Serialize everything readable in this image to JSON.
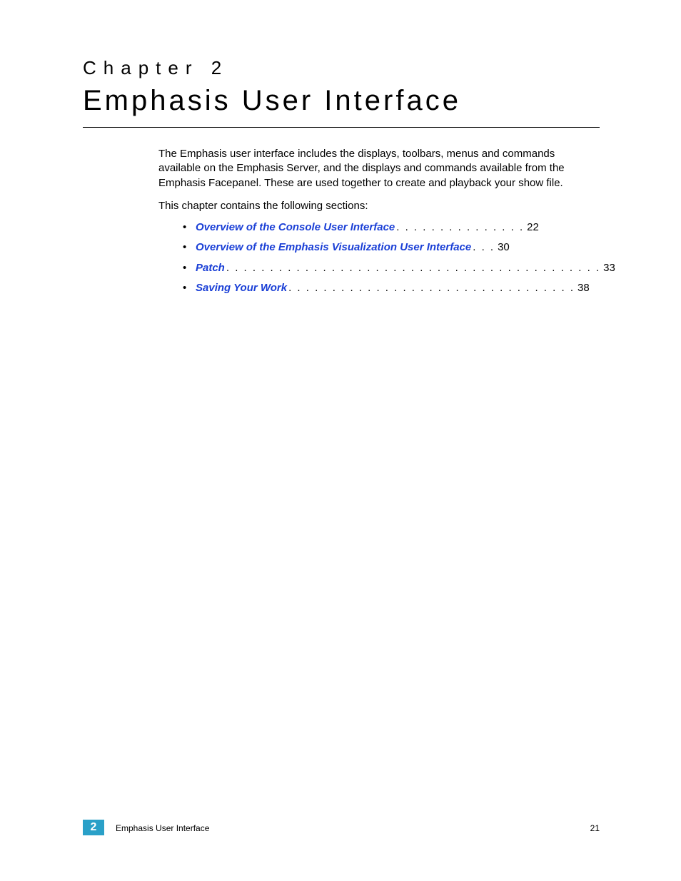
{
  "header": {
    "chapter_label": "Chapter 2",
    "title": "Emphasis User Interface"
  },
  "body": {
    "intro": "The Emphasis user interface includes the displays, toolbars, menus and commands available on the Emphasis Server, and the displays and commands available from the Emphasis Facepanel. These are used together to create and playback your show file.",
    "sections_line": "This chapter contains the following sections:"
  },
  "toc": [
    {
      "label": "Overview of the Console User Interface",
      "dots": ". . . . . . . . . . . . . . .",
      "page": "22"
    },
    {
      "label": "Overview of the Emphasis Visualization User Interface",
      "dots": ". . .",
      "page": "30"
    },
    {
      "label": "Patch",
      "dots": " . . . . . . . . . . . . . . . . . . . . . . . . . . . . . . . . . . . . . . . . . . .",
      "page": "33"
    },
    {
      "label": "Saving Your Work",
      "dots": ". . . . . . . . . . . . . . . . . . . . . . . . . . . . . . . . .",
      "page": "38"
    }
  ],
  "footer": {
    "chapter_number": "2",
    "title": "Emphasis User Interface",
    "page_number": "21"
  }
}
